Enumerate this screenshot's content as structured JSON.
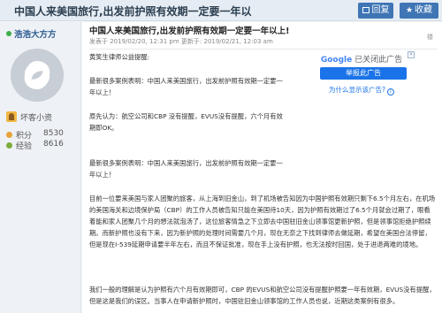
{
  "thread": {
    "title": "中国人来美国旅行,出发前护照有效期一定要一年以",
    "reply_label": "回复",
    "bookmark_label": "收藏"
  },
  "user": {
    "name": "浩浩大方方",
    "rank": "坏客小资",
    "stats": [
      {
        "label": "积分",
        "value": "8530"
      },
      {
        "label": "经验",
        "value": "8616"
      }
    ]
  },
  "post": {
    "title": "中国人来美国旅行,出发前护照有效期一定要一年以上!",
    "meta": "发表于 2019/02/20, 12:31 pm    更新于: 2019/02/21, 12:03 am",
    "floor": "楼",
    "paragraphs": [
      "黄笑生律师公益提醒:",
      "最新很多案例表明：中国人来美国旅行，出发前护照有效期一定要一年以上！",
      "原先认为：航空公司和CBP 没有提醒，EVUS没有提醒，六个月有效期即OK。",
      "最新很多案例表明：中国人来美国旅行，出发前护照有效期一定要一年以上！",
      "目前一位要来美国与家人团聚的旅客，从上海到旧金山，到了机场被告知因为中国护照有效期只剩下6.5个月左右，在机场的美国海关和边境保护局（CBP）的工作人员被告知只能在美国待10天，因为护照有效期过了6.5个月就会过期了，眼看着能和家人团聚几个月的想法就泡汤了，这位旅客情急之下立即去中国驻旧金山领事馆更新护照，但是领事馆拒绝护照续期。而新护照也没有下来，因为新护照的处理时间需要几个月，现在无奈之下找到律师去做延期，希望在美国合法停留，但是现在I-539延期申请要半年左右，而且不保证批准，现在手上没有护照，也无法按时回国，处于进退两难的境地。",
      "我们一般的理解是认为护照有六个月有效期即可，CBP 的EVUS和航空公司没有提醒护照要一年有效期，EVUS没有提醒，但是这是我们的误区。当事人在申请新护照时，中国驻旧金山领事馆的工作人员也说，近期这类案例有很多。"
    ]
  },
  "ad": {
    "brand": "Google",
    "status_text": "已关闭此广告",
    "stop_label": "举报此广告",
    "why_label": "为什么显示该广告?",
    "info_glyph": "i",
    "close_glyph": "×"
  },
  "colors": {
    "accent": "#3f75b5",
    "google_blue": "#1a73e8"
  }
}
